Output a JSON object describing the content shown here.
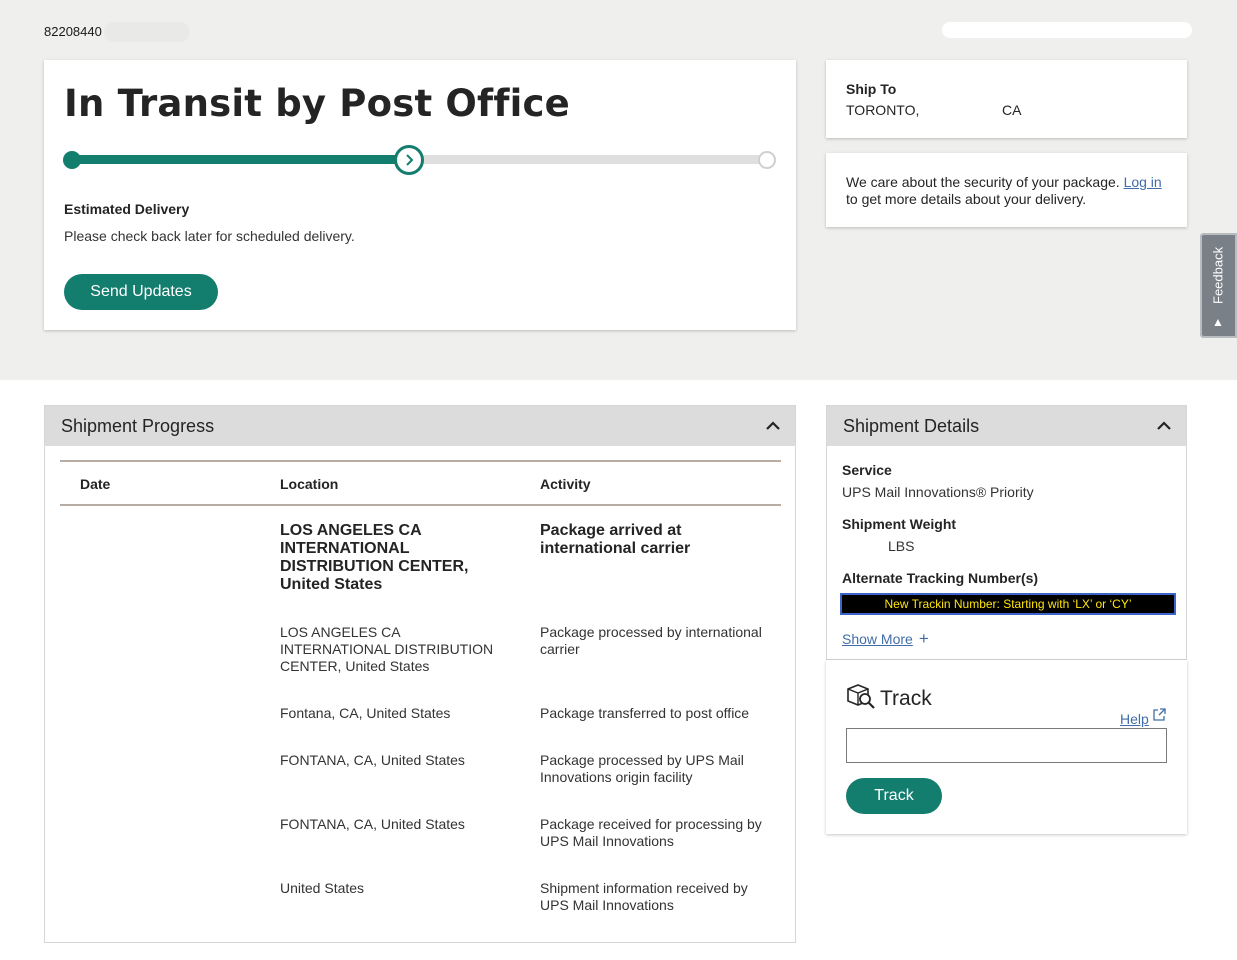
{
  "header": {
    "tracking_number": "82208440"
  },
  "status": {
    "title": "In Transit by Post Office",
    "progress_fraction": 0.5,
    "estimated_delivery_label": "Estimated Delivery",
    "estimated_delivery_text": "Please check back later for scheduled delivery.",
    "send_updates_label": "Send Updates"
  },
  "ship_to": {
    "label": "Ship To",
    "city": "TORONTO,",
    "country": "CA"
  },
  "security": {
    "text_before": "We care about the security of your package. ",
    "link_label": "Log in",
    "text_after": " to get more details about your delivery."
  },
  "feedback": {
    "label": "Feedback"
  },
  "shipment_progress": {
    "title": "Shipment Progress",
    "columns": [
      "Date",
      "Location",
      "Activity"
    ],
    "rows": [
      {
        "location": "LOS ANGELES CA INTERNATIONAL DISTRIBUTION CENTER, United States",
        "activity": "Package arrived at international carrier"
      },
      {
        "location": "LOS ANGELES CA INTERNATIONAL DISTRIBUTION CENTER, United States",
        "activity": "Package processed by international carrier"
      },
      {
        "location": "Fontana, CA, United States",
        "activity": "Package transferred to post office"
      },
      {
        "location": "FONTANA, CA, United States",
        "activity": "Package processed by UPS Mail Innovations origin facility"
      },
      {
        "location": "FONTANA, CA, United States",
        "activity": "Package received for processing by UPS Mail Innovations"
      },
      {
        "location": "United States",
        "activity": "Shipment information received by UPS Mail Innovations"
      }
    ]
  },
  "shipment_details": {
    "title": "Shipment Details",
    "service_label": "Service",
    "service_value": "UPS Mail Innovations® Priority",
    "weight_label": "Shipment Weight",
    "weight_value": "LBS",
    "alt_tracking_label": "Alternate Tracking Number(s)",
    "alt_tracking_value": "New Trackin Number: Starting with ‘LX’ or ‘CY’",
    "show_more_label": "Show More"
  },
  "track": {
    "title": "Track",
    "help_label": "Help",
    "input_value": "",
    "button_label": "Track"
  },
  "colors": {
    "accent": "#137d6e",
    "link": "#426da9",
    "alt_tracking_text": "#ffe60a"
  }
}
